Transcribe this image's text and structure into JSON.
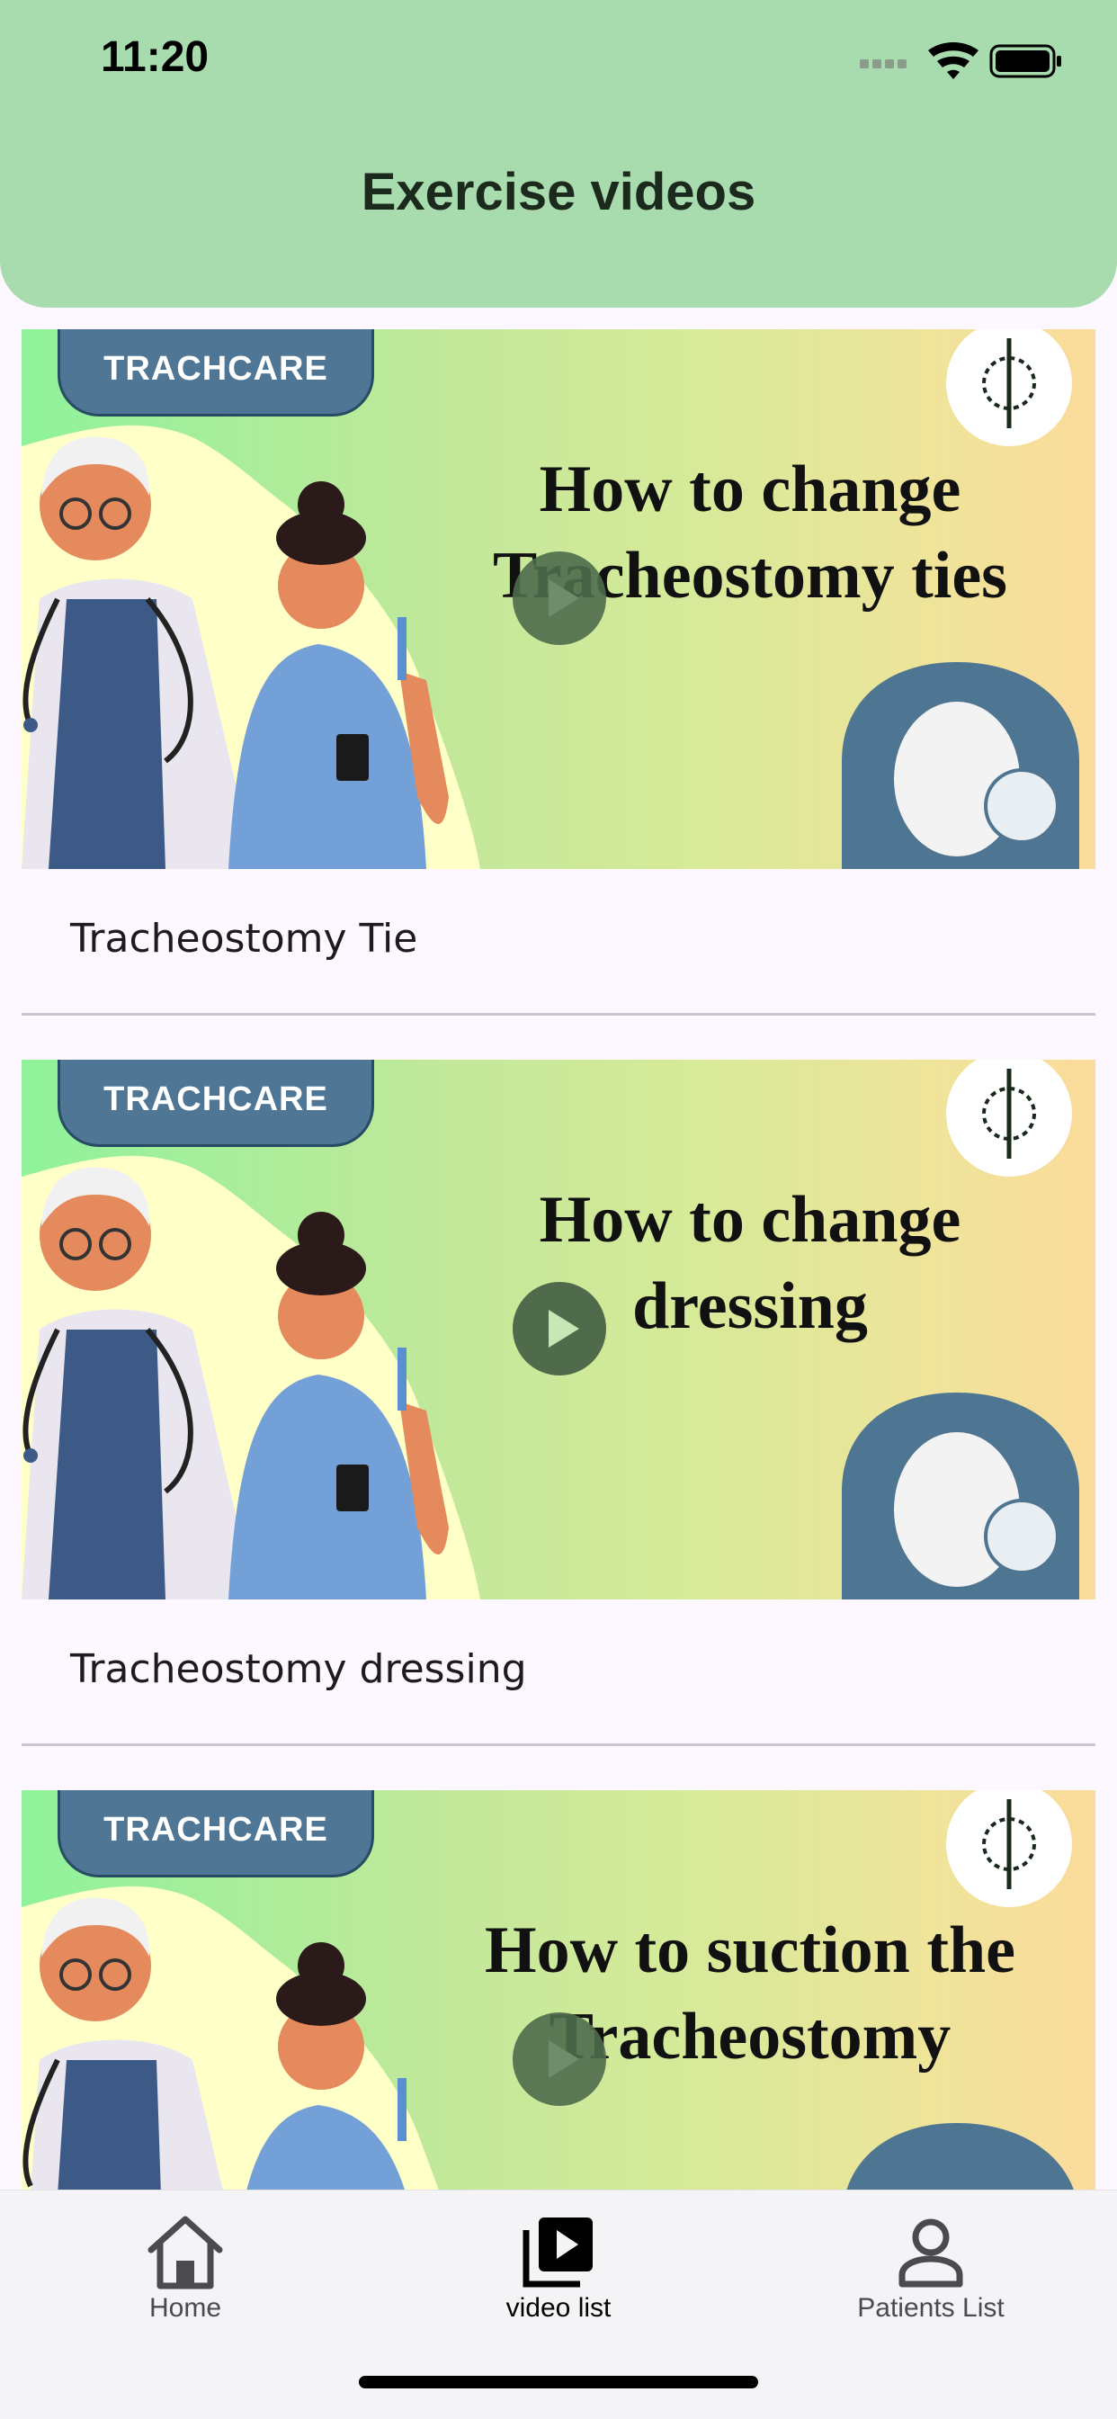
{
  "status_bar": {
    "time": "11:20",
    "icons": [
      "cellular-icon",
      "wifi-icon",
      "battery-icon"
    ]
  },
  "header": {
    "title": "Exercise videos",
    "background": "#a8dbad"
  },
  "videos": [
    {
      "brand": "TRACHCARE",
      "thumbnail_lines": [
        "How to change",
        "Tracheostomy ties"
      ],
      "caption": "Tracheostomy Tie"
    },
    {
      "brand": "TRACHCARE",
      "thumbnail_lines": [
        "How to change",
        "dressing"
      ],
      "caption": "Tracheostomy dressing"
    },
    {
      "brand": "TRACHCARE",
      "thumbnail_lines": [
        "How to suction the",
        "Tracheostomy"
      ],
      "caption": ""
    }
  ],
  "tab_bar": {
    "items": [
      {
        "label": "Home",
        "icon": "home-icon",
        "active": false
      },
      {
        "label": "video list",
        "icon": "video-library-icon",
        "active": true
      },
      {
        "label": "Patients List",
        "icon": "person-icon",
        "active": false
      }
    ]
  },
  "colors": {
    "accent": "#a8dbad",
    "brand_pill": "#4f7795",
    "play_button": "#4f6b4c"
  }
}
